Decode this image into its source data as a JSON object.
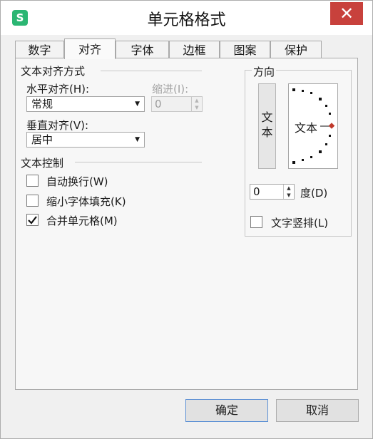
{
  "dialog": {
    "title": "单元格格式",
    "app_icon_letter": "S",
    "close_symbol": "✕"
  },
  "tabs": [
    "数字",
    "对齐",
    "字体",
    "边框",
    "图案",
    "保护"
  ],
  "active_tab": "对齐",
  "alignment": {
    "section_title": "文本对齐方式",
    "horizontal_label": "水平对齐(H):",
    "horizontal_value": "常规",
    "indent_label": "缩进(I):",
    "indent_value": "0",
    "vertical_label": "垂直对齐(V):",
    "vertical_value": "居中"
  },
  "text_control": {
    "section_title": "文本控制",
    "options": [
      {
        "label": "自动换行(W)",
        "checked": false
      },
      {
        "label": "缩小字体填充(K)",
        "checked": false
      },
      {
        "label": "合并单元格(M)",
        "checked": true
      }
    ]
  },
  "orientation": {
    "title": "方向",
    "vertical_text": "文本",
    "horizontal_text": "文本",
    "degree_value": "0",
    "degree_label": "度(D)",
    "vertical_stack_label": "文字竖排(L)",
    "vertical_stack_checked": false
  },
  "buttons": {
    "ok": "确定",
    "cancel": "取消"
  },
  "icons": {
    "close": "close-icon",
    "dropdown": "chevron-down-icon",
    "spin_up": "spin-up-icon",
    "spin_down": "spin-down-icon",
    "check": "checkmark-icon"
  },
  "colors": {
    "close_button": "#c8413c",
    "app_icon": "#2bb673",
    "orientation_marker": "#c0392b"
  }
}
